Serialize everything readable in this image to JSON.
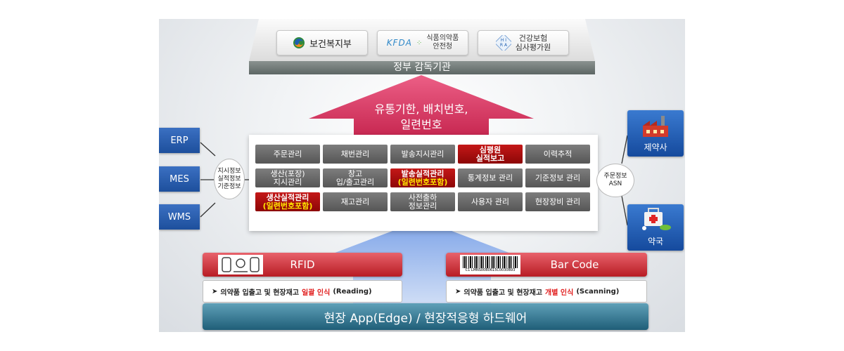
{
  "agencies": {
    "mohw": "보건복지부",
    "kfda_logo": "KFDA",
    "kfda_name_line1": "식품의약품",
    "kfda_name_line2": "안전청",
    "hira_name_line1": "건강보험",
    "hira_name_line2": "심사평가원"
  },
  "gov_label": "정부 감독기관",
  "arrow_text_line1": "유통기한, 배치번호,",
  "arrow_text_line2": "일련번호",
  "modules": [
    {
      "l1": "주문관리",
      "l2": "",
      "style": "normal"
    },
    {
      "l1": "채번관리",
      "l2": "",
      "style": "normal"
    },
    {
      "l1": "발송지시관리",
      "l2": "",
      "style": "normal"
    },
    {
      "l1": "심평원",
      "l2": "실적보고",
      "style": "hl"
    },
    {
      "l1": "이력추적",
      "l2": "",
      "style": "normal"
    },
    {
      "l1": "생산(포장)",
      "l2": "지시관리",
      "style": "normal"
    },
    {
      "l1": "창고",
      "l2": "입/출고관리",
      "style": "normal"
    },
    {
      "l1": "발송실적관리",
      "l2": "(일련번호포함)",
      "style": "hl yellow"
    },
    {
      "l1": "통계정보 관리",
      "l2": "",
      "style": "normal"
    },
    {
      "l1": "기준정보 관리",
      "l2": "",
      "style": "normal"
    },
    {
      "l1": "생산실적관리",
      "l2": "(일련번호포함)",
      "style": "hl yellow"
    },
    {
      "l1": "재고관리",
      "l2": "",
      "style": "normal"
    },
    {
      "l1": "사전출하",
      "l2": "정보관리",
      "style": "normal"
    },
    {
      "l1": "사용자 관리",
      "l2": "",
      "style": "normal"
    },
    {
      "l1": "현장장비 관리",
      "l2": "",
      "style": "normal"
    }
  ],
  "left_systems": [
    "ERP",
    "MES",
    "WMS"
  ],
  "left_info_lines": [
    "지시정보",
    "실적정보",
    "기준정보"
  ],
  "right_info_lines": [
    "주문정보",
    "ASN"
  ],
  "right_tiles": {
    "pharma": "제약사",
    "pharmacy": "약국"
  },
  "rfid": {
    "label": "RFID",
    "desc_prefix": "의약품 입출고 및 현장재고",
    "desc_highlight": "일괄 인식",
    "desc_suffix": "(Reading)"
  },
  "barcode": {
    "label": "Bar Code",
    "barcode_text": "C1 LMNS00B0615C0030B93",
    "desc_prefix": "의약품 입출고 및 현장재고",
    "desc_highlight": "개별 인식",
    "desc_suffix": "(Scanning)"
  },
  "edge_label": "현장 App(Edge) / 현장적응형 하드웨어",
  "bullet": "➤",
  "colors": {
    "arrow_pink": "#d9336a",
    "module_gray": "#666666",
    "module_red": "#a80d0d",
    "system_blue": "#2a5fb0",
    "rfid_red": "#c8262e",
    "edge_teal": "#3b7f98"
  }
}
